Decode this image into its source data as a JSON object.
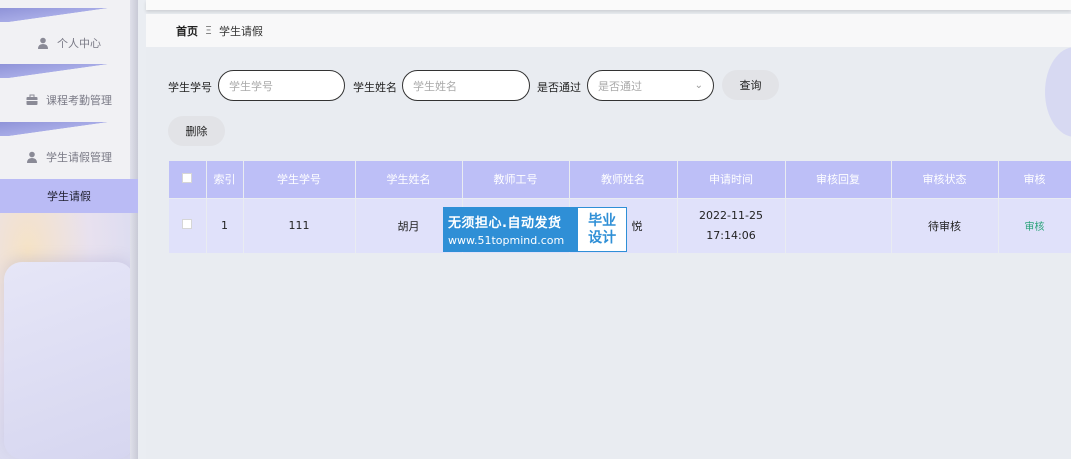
{
  "sidebar": {
    "items": [
      {
        "label": "个人中心",
        "icon": "user-icon",
        "active": false
      },
      {
        "label": "课程考勤管理",
        "icon": "briefcase-icon",
        "active": false
      },
      {
        "label": "学生请假管理",
        "icon": "user-icon",
        "active": false
      },
      {
        "label": "学生请假",
        "icon": "",
        "active": true
      }
    ]
  },
  "breadcrumb": {
    "home": "首页",
    "separator": "Ξ",
    "current": "学生请假"
  },
  "search": {
    "student_no_label": "学生学号",
    "student_no_placeholder": "学生学号",
    "student_name_label": "学生姓名",
    "student_name_placeholder": "学生姓名",
    "passed_label": "是否通过",
    "passed_placeholder": "是否通过",
    "query_button": "查询"
  },
  "actions": {
    "delete_button": "删除"
  },
  "table": {
    "columns": [
      "索引",
      "学生学号",
      "学生姓名",
      "教师工号",
      "教师姓名",
      "申请时间",
      "审核回复",
      "审核状态",
      "审核"
    ],
    "rows": [
      {
        "index": "1",
        "student_no": "111",
        "student_name": "胡月",
        "teacher_no": "",
        "teacher_name": "悦",
        "apply_time": "2022-11-25 17:14:06",
        "reply": "",
        "status": "待审核",
        "action": "审核"
      }
    ]
  },
  "watermark": {
    "slogan": "无须担心.自动发货",
    "url": "www.51topmind.com",
    "badge_line1": "毕业",
    "badge_line2": "设计"
  },
  "colors": {
    "accent": "#bdbff7",
    "active_menu": "#babbf5",
    "row_bg": "#e0e1fa",
    "audit_link": "#2aa37a",
    "watermark": "#2f8fd6"
  }
}
